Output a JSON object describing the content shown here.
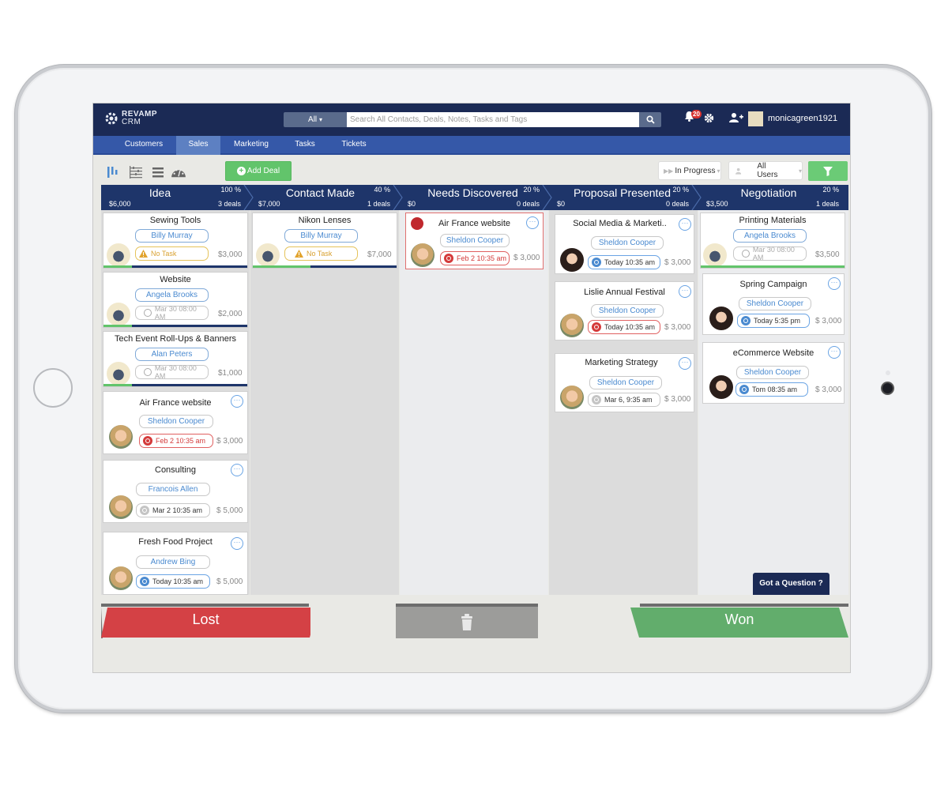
{
  "app": {
    "brand_line1": "REVAMP",
    "brand_line2": "CRM"
  },
  "header": {
    "search_scope": "All",
    "search_placeholder": "Search All Contacts, Deals, Notes, Tasks and Tags",
    "notification_count": "20",
    "username": "monicagreen1921"
  },
  "nav": {
    "tabs": [
      {
        "label": "Customers",
        "active": false
      },
      {
        "label": "Sales",
        "active": true
      },
      {
        "label": "Marketing",
        "active": false
      },
      {
        "label": "Tasks",
        "active": false
      },
      {
        "label": "Tickets",
        "active": false
      }
    ]
  },
  "toolbar": {
    "add_deal_label": "Add Deal",
    "status_filter": "In Progress",
    "user_filter": "All Users",
    "views": [
      "pipeline-view",
      "timeline-view",
      "list-view",
      "dashboard-view"
    ]
  },
  "stages": [
    {
      "name": "Idea",
      "percent": "100 %",
      "amount": "$6,000",
      "deals": "3 deals"
    },
    {
      "name": "Contact Made",
      "percent": "40 %",
      "amount": "$7,000",
      "deals": "1 deals"
    },
    {
      "name": "Needs Discovered",
      "percent": "20 %",
      "amount": "$0",
      "deals": "0 deals"
    },
    {
      "name": "Proposal Presented",
      "percent": "20 %",
      "amount": "$0",
      "deals": "0 deals"
    },
    {
      "name": "Negotiation",
      "percent": "20 %",
      "amount": "$3,500",
      "deals": "1 deals"
    }
  ],
  "columns": [
    {
      "cards": [
        {
          "title": "Sewing Tools",
          "contact": "Billy Murray",
          "task": "No Task",
          "task_state": "warning",
          "amount": "$3,000",
          "progress": 0.2
        },
        {
          "title": "Website",
          "contact": "Angela Brooks",
          "task": "Mar 30 08:00 AM",
          "task_state": "muted",
          "amount": "$2,000",
          "progress": 0.2
        },
        {
          "title": "Tech Event Roll-Ups & Banners",
          "contact": "Alan Peters",
          "task": "Mar 30 08:00 AM",
          "task_state": "muted",
          "amount": "$1,000",
          "progress": 0.2
        },
        {
          "title": "Air France website",
          "contact": "Sheldon Cooper",
          "task": "Feb 2 10:35 am",
          "task_state": "overdue",
          "amount": "$ 3,000"
        },
        {
          "title": "Consulting",
          "contact": "Francois Allen",
          "task": "Mar 2 10:35 am",
          "task_state": "future",
          "amount": "$ 5,000"
        },
        {
          "title": "Fresh Food Project",
          "contact": "Andrew Bing",
          "task": "Today 10:35 am",
          "task_state": "today",
          "amount": "$ 5,000"
        }
      ]
    },
    {
      "cards": [
        {
          "title": "Nikon Lenses",
          "contact": "Billy Murray",
          "task": "No Task",
          "task_state": "warning",
          "amount": "$7,000",
          "progress": 0.4
        }
      ]
    },
    {
      "cards": [
        {
          "title": "Air France website",
          "contact": "Sheldon Cooper",
          "task": "Feb 2 10:35 am",
          "task_state": "overdue",
          "amount": "$ 3,000"
        }
      ]
    },
    {
      "cards": [
        {
          "title": "Social Media & Marketi..",
          "contact": "Sheldon Cooper",
          "task": "Today 10:35 am",
          "task_state": "today",
          "amount": "$ 3,000"
        },
        {
          "title": "Lislie Annual Festival",
          "contact": "Sheldon Cooper",
          "task": "Today 10:35 am",
          "task_state": "overdue",
          "amount": "$ 3,000"
        },
        {
          "title": "Marketing Strategy",
          "contact": "Sheldon Cooper",
          "task": "Mar 6, 9:35 am",
          "task_state": "future",
          "amount": "$ 3,000"
        }
      ]
    },
    {
      "cards": [
        {
          "title": "Printing Materials",
          "contact": "Angela Brooks",
          "task": "Mar 30 08:00 AM",
          "task_state": "muted",
          "amount": "$3,500",
          "progress": 1.0
        },
        {
          "title": "Spring Campaign",
          "contact": "Sheldon Cooper",
          "task": "Today 5:35 pm",
          "task_state": "today",
          "amount": "$ 3,000"
        },
        {
          "title": "eCommerce Website",
          "contact": "Sheldon Cooper",
          "task": "Tom 08:35 am",
          "task_state": "today",
          "amount": "$ 3,000"
        }
      ]
    }
  ],
  "dropzones": {
    "lost": "Lost",
    "won": "Won"
  },
  "help": {
    "label": "Got a Question ?"
  },
  "colors": {
    "header_bg": "#1b2a55",
    "nav_bg": "#3558a8",
    "stage_bg": "#1e356a",
    "add_green": "#62c46b",
    "lost_red": "#d44145",
    "won_green": "#62ad6c",
    "link_blue": "#4a8ad0"
  }
}
